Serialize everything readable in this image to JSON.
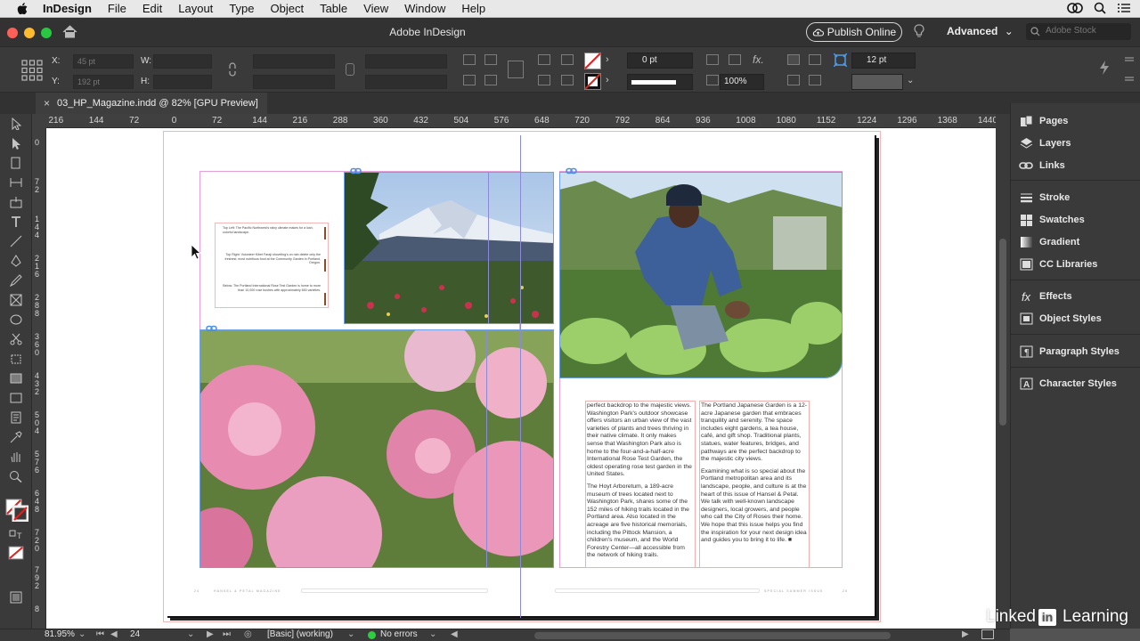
{
  "menubar": {
    "app": "InDesign",
    "items": [
      "File",
      "Edit",
      "Layout",
      "Type",
      "Object",
      "Table",
      "View",
      "Window",
      "Help"
    ]
  },
  "titlebar": {
    "title": "Adobe InDesign",
    "publish_label": "Publish Online",
    "workspace": "Advanced",
    "stock_placeholder": "Adobe Stock"
  },
  "control": {
    "x_label": "X:",
    "x_value": "45 pt",
    "y_label": "Y:",
    "y_value": "192 pt",
    "w_label": "W:",
    "h_label": "H:",
    "stroke_weight": "0 pt",
    "opacity": "100%",
    "gutter": "12 pt"
  },
  "document_tab": {
    "close": "×",
    "label": "03_HP_Magazine.indd @ 82% [GPU Preview]"
  },
  "ruler": {
    "h_ticks": [
      "216",
      "144",
      "72",
      "0",
      "72",
      "144",
      "216",
      "288",
      "360",
      "432",
      "504",
      "576",
      "648",
      "720",
      "792",
      "864",
      "936",
      "1008",
      "1080",
      "1152",
      "1224",
      "1296",
      "1368",
      "1440"
    ],
    "v_ticks": [
      "0",
      "7 2",
      "1 4 4",
      "2 1 6",
      "2 8 8",
      "3 6 0",
      "4 3 2",
      "5 0 4",
      "5 7 6",
      "6 4 8",
      "7 2 0",
      "7 9 2",
      "8"
    ]
  },
  "captions": {
    "top_left": "Top Left: The Pacific Northwest's rainy climate makes for a lush, colorful landscape.",
    "top_right": "Top Right: Volunteer Kibet Faraji shoveling's on rain delete only the freshest, most nutritious food at the Community Garden in Portland, Oregon.",
    "below": "Below: The Portland International Rose Test Garden is home to more than 10,000 rose bushes with approximately 650 varieties."
  },
  "body_text": {
    "col1": [
      "perfect backdrop to the majestic views. Washington Park's outdoor showcase offers visitors an urban view of the vast varieties of plants and trees thriving in their native climate. It only makes sense that Washington Park also is home to the four-and-a-half-acre International Rose Test Garden, the oldest operating rose test garden in the United States.",
      "The Hoyt Arboretum, a 189-acre museum of trees located next to Washington Park, shares some of the 152 miles of hiking trails located in the Portland area. Also located in the acreage are five historical memorials, including the Pittock Mansion, a children's museum, and the World Forestry Center—all accessible from the network of hiking trails."
    ],
    "col2": [
      "The Portland Japanese Garden is a 12-acre Japanese garden that embraces tranquility and serenity. The space includes eight gardens, a tea house, café, and gift shop. Traditional plants, statues, water features, bridges, and pathways are the perfect backdrop to the majestic city views.",
      "Examining what is so special about the Portland metropolitan area and its landscape, people, and culture is at the heart of this issue of Hansel & Petal. We talk with well-known landscape designers, local growers, and people who call the City of Roses their home. We hope that this issue helps you find the inspiration for your next design idea and guides you to bring it to life. ■"
    ]
  },
  "folio": {
    "left_num": "24",
    "left_text": "HANSEL & PETAL MAGAZINE",
    "right_text": "SPECIAL SUMMER ISSUE",
    "right_num": "25"
  },
  "panels": [
    {
      "label": "Pages",
      "icon": "pages-icon"
    },
    {
      "label": "Layers",
      "icon": "layers-icon"
    },
    {
      "label": "Links",
      "icon": "links-icon"
    },
    {
      "label": "Stroke",
      "icon": "stroke-icon"
    },
    {
      "label": "Swatches",
      "icon": "swatches-icon"
    },
    {
      "label": "Gradient",
      "icon": "gradient-icon"
    },
    {
      "label": "CC Libraries",
      "icon": "cc-libraries-icon"
    },
    {
      "label": "Effects",
      "icon": "effects-icon"
    },
    {
      "label": "Object Styles",
      "icon": "object-styles-icon"
    },
    {
      "label": "Paragraph Styles",
      "icon": "paragraph-styles-icon"
    },
    {
      "label": "Character Styles",
      "icon": "character-styles-icon"
    }
  ],
  "status": {
    "zoom": "81.95%",
    "page": "24",
    "profile": "[Basic] (working)",
    "preflight": "No errors"
  },
  "watermark": {
    "brand": "Linked",
    "in": "in",
    "suffix": "Learning"
  },
  "colors": {
    "accent": "#e5a1d8",
    "selection": "#6fa0e6",
    "preflight_ok": "#2ecc40"
  }
}
